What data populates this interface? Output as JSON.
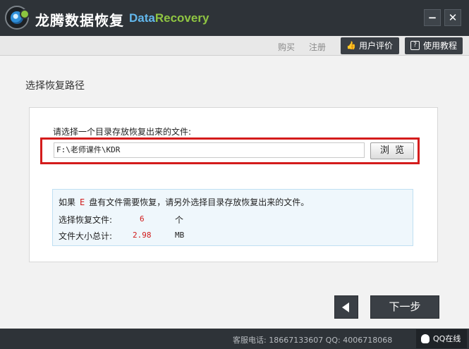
{
  "titlebar": {
    "title": "龙腾数据恢复",
    "brand_part1": "Data",
    "brand_part2": "Recovery",
    "minimize_glyph": "−",
    "close_glyph": "✕"
  },
  "toolbar": {
    "buy": "购买",
    "register": "注册",
    "reviews": "用户评价",
    "tutorial": "使用教程"
  },
  "main": {
    "section_title": "选择恢复路径",
    "prompt": "请选择一个目录存放恢复出来的文件:",
    "path_value": "F:\\老师课件\\KDR",
    "browse_label": "浏览",
    "info": {
      "prefix": "如果",
      "drive": "E",
      "suffix": "盘有文件需要恢复，请另外选择目录存放恢复出来的文件。",
      "files_label": "选择恢复文件:",
      "files_count": "6",
      "files_unit": "个",
      "size_label": "文件大小总计:",
      "size_value": "2.98",
      "size_unit": "MB"
    }
  },
  "nav": {
    "next_label": "下一步"
  },
  "statusbar": {
    "contact": "客服电话: 18667133607 QQ: 4006718068",
    "qq_label": "QQ在线"
  },
  "colors": {
    "titlebar": "#2e3338",
    "brand_blue": "#62b7ec",
    "brand_green": "#8fc542",
    "highlight_red": "#d41c1c"
  },
  "icons": [
    "app-logo-icon",
    "minimize-icon",
    "close-icon",
    "thumbs-up-icon",
    "help-book-icon",
    "back-arrow-icon",
    "qq-penguin-icon"
  ]
}
